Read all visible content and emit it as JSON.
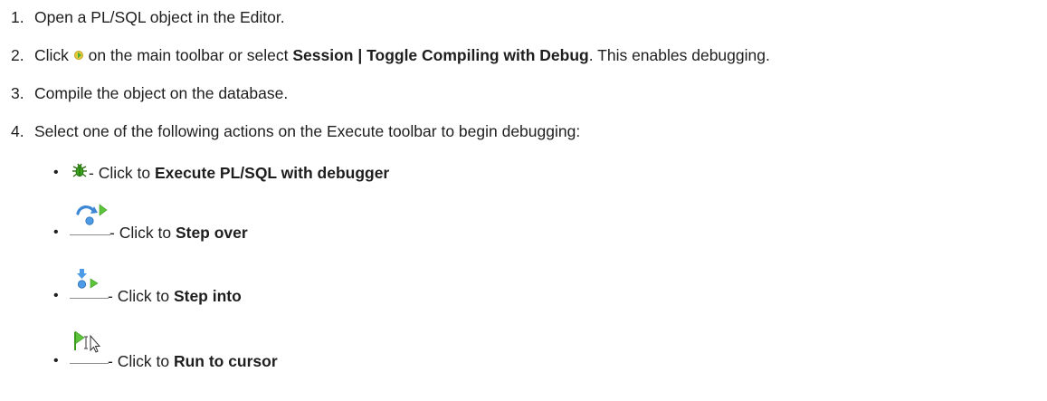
{
  "steps": [
    {
      "num": "1.",
      "text": "Open a PL/SQL object in the Editor."
    },
    {
      "num": "2.",
      "pre": "Click",
      "icon": "toggle-debug-icon",
      "mid": "on the main toolbar or select",
      "bold": "Session | Toggle Compiling with Debug",
      "post": ". This enables debugging."
    },
    {
      "num": "3.",
      "text": "Compile the object on the database."
    },
    {
      "num": "4.",
      "text": "Select one of the following actions on the Execute toolbar to begin debugging:"
    }
  ],
  "bullet_glyph": "•",
  "actions": [
    {
      "icon": "bug-debugger-icon",
      "prefix": "- Click to",
      "bold": "Execute PL/SQL with debugger"
    },
    {
      "icon": "step-over-icon",
      "prefix": "- Click to",
      "bold": "Step over"
    },
    {
      "icon": "step-into-icon",
      "prefix": "- Click to",
      "bold": "Step into"
    },
    {
      "icon": "run-to-cursor-icon",
      "prefix": "- Click to",
      "bold": "Run to cursor"
    }
  ]
}
